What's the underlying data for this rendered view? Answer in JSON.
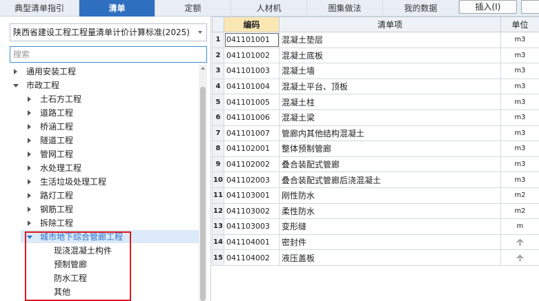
{
  "tabs": [
    {
      "label": "典型清单指引",
      "active": false
    },
    {
      "label": "清单",
      "active": true
    },
    {
      "label": "定额",
      "active": false
    },
    {
      "label": "人材机",
      "active": false
    },
    {
      "label": "图集做法",
      "active": false
    },
    {
      "label": "我的数据",
      "active": false
    }
  ],
  "toolbar": {
    "insert_label": "插入(I)"
  },
  "left": {
    "standard_selected": "陕西省建设工程工程量清单计价计算标准(2025)",
    "search_placeholder": "搜索",
    "tree": [
      {
        "label": "通用安装工程",
        "level": 0,
        "state": "collapsed"
      },
      {
        "label": "市政工程",
        "level": 0,
        "state": "expanded"
      },
      {
        "label": "土石方工程",
        "level": 1,
        "state": "collapsed"
      },
      {
        "label": "道路工程",
        "level": 1,
        "state": "collapsed"
      },
      {
        "label": "桥涵工程",
        "level": 1,
        "state": "collapsed"
      },
      {
        "label": "隧道工程",
        "level": 1,
        "state": "collapsed"
      },
      {
        "label": "管网工程",
        "level": 1,
        "state": "collapsed"
      },
      {
        "label": "水处理工程",
        "level": 1,
        "state": "collapsed"
      },
      {
        "label": "生活垃圾处理工程",
        "level": 1,
        "state": "collapsed"
      },
      {
        "label": "路灯工程",
        "level": 1,
        "state": "collapsed"
      },
      {
        "label": "钢筋工程",
        "level": 1,
        "state": "collapsed"
      },
      {
        "label": "拆除工程",
        "level": 1,
        "state": "collapsed"
      },
      {
        "label": "城市地下综合管廊工程",
        "level": 1,
        "state": "expanded",
        "selected": true
      },
      {
        "label": "现浇混凝土构件",
        "level": 2,
        "state": "leaf"
      },
      {
        "label": "预制管廊",
        "level": 2,
        "state": "leaf"
      },
      {
        "label": "防水工程",
        "level": 2,
        "state": "leaf"
      },
      {
        "label": "其他",
        "level": 2,
        "state": "leaf"
      }
    ],
    "highlight_color": "#e0161d"
  },
  "table": {
    "headers": [
      "编码",
      "清单项",
      "单位"
    ],
    "rows": [
      {
        "idx": "1",
        "code": "041101001",
        "name": "混凝土垫层",
        "unit": "m3"
      },
      {
        "idx": "2",
        "code": "041101002",
        "name": "混凝土底板",
        "unit": "m3"
      },
      {
        "idx": "3",
        "code": "041101003",
        "name": "混凝土墙",
        "unit": "m3"
      },
      {
        "idx": "4",
        "code": "041101004",
        "name": "混凝土平台、顶板",
        "unit": "m3"
      },
      {
        "idx": "5",
        "code": "041101005",
        "name": "混凝土柱",
        "unit": "m3"
      },
      {
        "idx": "6",
        "code": "041101006",
        "name": "混凝土梁",
        "unit": "m3"
      },
      {
        "idx": "7",
        "code": "041101007",
        "name": "管廊内其他结构混凝土",
        "unit": "m3"
      },
      {
        "idx": "8",
        "code": "041102001",
        "name": "整体预制管廊",
        "unit": "m3"
      },
      {
        "idx": "9",
        "code": "041102002",
        "name": "叠合装配式管廊",
        "unit": "m3"
      },
      {
        "idx": "10",
        "code": "041102003",
        "name": "叠合装配式管廊后浇混凝土",
        "unit": "m3"
      },
      {
        "idx": "11",
        "code": "041103001",
        "name": "刚性防水",
        "unit": "m2"
      },
      {
        "idx": "12",
        "code": "041103002",
        "name": "柔性防水",
        "unit": "m2"
      },
      {
        "idx": "13",
        "code": "041103003",
        "name": "变形缝",
        "unit": "m"
      },
      {
        "idx": "14",
        "code": "041104001",
        "name": "密封件",
        "unit": "个"
      },
      {
        "idx": "15",
        "code": "041104002",
        "name": "液压盖板",
        "unit": "个"
      }
    ]
  },
  "colors": {
    "accent": "#2f6fbf",
    "selected_text": "#2c6fcf",
    "code_header": "#fbe7b4"
  }
}
